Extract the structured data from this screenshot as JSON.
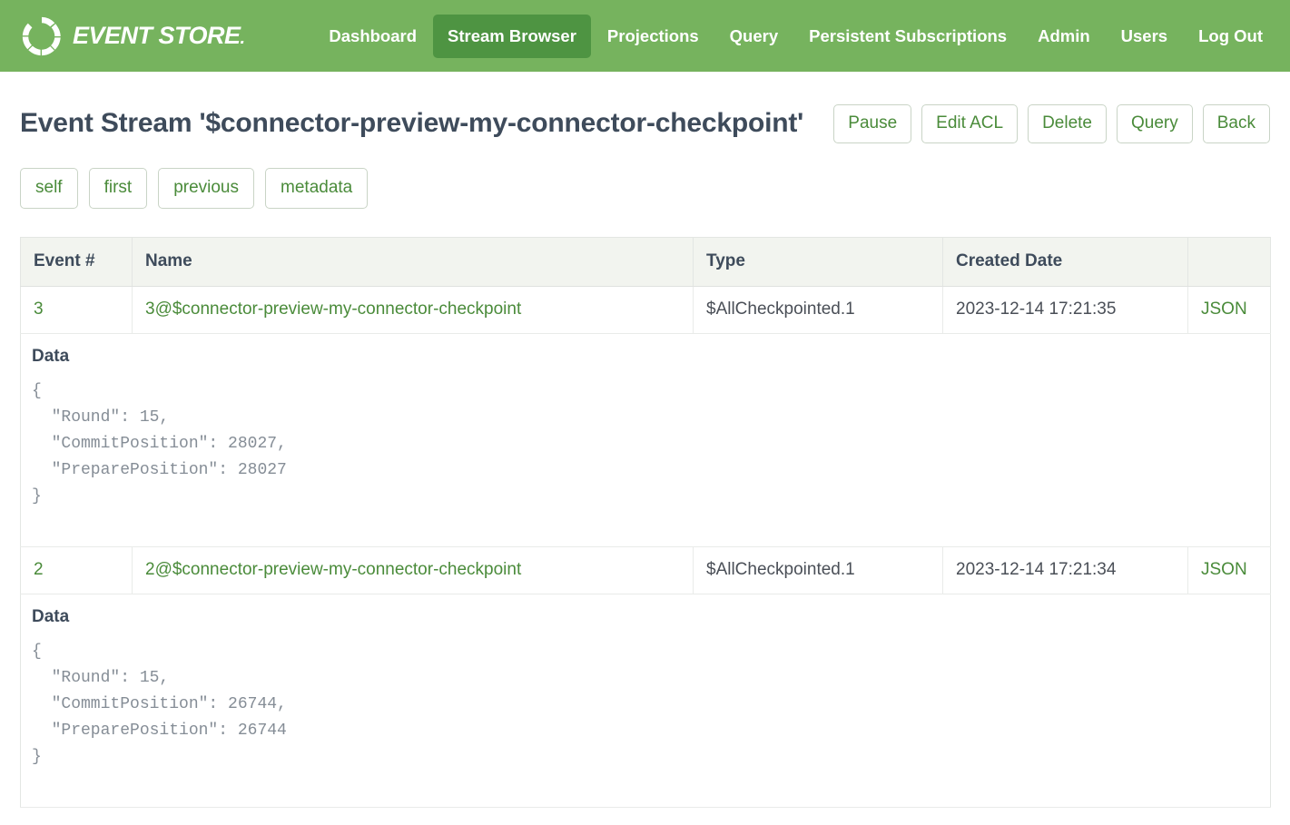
{
  "navbar": {
    "brand": {
      "name": "EVENT STORE",
      "suffix": ".",
      "logo_icon": "event-store-ring-logo"
    },
    "links": [
      {
        "label": "Dashboard",
        "active": false
      },
      {
        "label": "Stream Browser",
        "active": true
      },
      {
        "label": "Projections",
        "active": false
      },
      {
        "label": "Query",
        "active": false
      },
      {
        "label": "Persistent Subscriptions",
        "active": false
      },
      {
        "label": "Admin",
        "active": false
      },
      {
        "label": "Users",
        "active": false
      },
      {
        "label": "Log Out",
        "active": false
      }
    ],
    "background_color": "#76b35e",
    "active_background_color": "#4e9442"
  },
  "page": {
    "title": "Event Stream '$connector-preview-my-connector-checkpoint'",
    "actions": [
      {
        "label": "Pause"
      },
      {
        "label": "Edit ACL"
      },
      {
        "label": "Delete"
      },
      {
        "label": "Query"
      },
      {
        "label": "Back"
      }
    ],
    "nav_links": [
      {
        "label": "self"
      },
      {
        "label": "first"
      },
      {
        "label": "previous"
      },
      {
        "label": "metadata"
      }
    ],
    "link_color": "#4a8b3a"
  },
  "table": {
    "columns": [
      {
        "key": "event",
        "label": "Event #"
      },
      {
        "key": "name",
        "label": "Name"
      },
      {
        "key": "type",
        "label": "Type"
      },
      {
        "key": "created",
        "label": "Created Date"
      },
      {
        "key": "format",
        "label": ""
      }
    ],
    "rows": [
      {
        "event": "3",
        "name": "3@$connector-preview-my-connector-checkpoint",
        "type": "$AllCheckpointed.1",
        "created": "2023-12-14 17:21:35",
        "format": "JSON",
        "data_label": "Data",
        "data_json": "{\n  \"Round\": 15,\n  \"CommitPosition\": 28027,\n  \"PreparePosition\": 28027\n}"
      },
      {
        "event": "2",
        "name": "2@$connector-preview-my-connector-checkpoint",
        "type": "$AllCheckpointed.1",
        "created": "2023-12-14 17:21:34",
        "format": "JSON",
        "data_label": "Data",
        "data_json": "{\n  \"Round\": 15,\n  \"CommitPosition\": 26744,\n  \"PreparePosition\": 26744\n}"
      }
    ]
  }
}
